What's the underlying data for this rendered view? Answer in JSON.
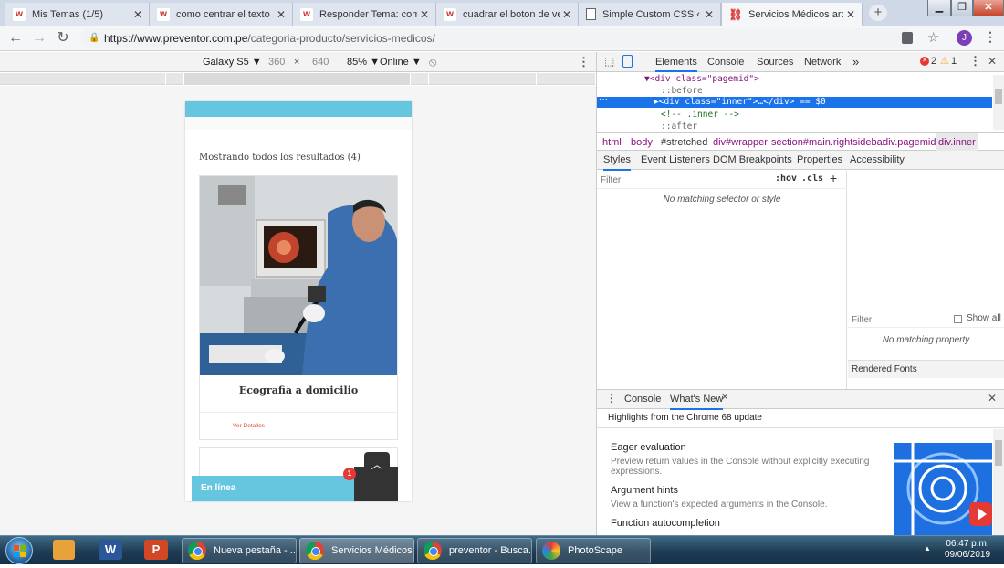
{
  "browser": {
    "tabs": [
      {
        "title": "Mis Temas (1/5)",
        "icon": "w-icon"
      },
      {
        "title": "como centrar el texto",
        "icon": "w-icon"
      },
      {
        "title": "Responder Tema: como",
        "icon": "w-icon"
      },
      {
        "title": "cuadrar el boton de ver",
        "icon": "w-icon"
      },
      {
        "title": "Simple Custom CSS ‹ PR",
        "icon": "doc-icon"
      },
      {
        "title": "Servicios Médicos archiv",
        "icon": "chain-icon"
      }
    ],
    "url_host": "https://www.preventor.com.pe",
    "url_path": "/categoria-producto/servicios-medicos/",
    "profile_initial": "J"
  },
  "device_toolbar": {
    "device": "Galaxy S5 ▼",
    "width": "360",
    "times": "×",
    "height": "640",
    "zoom": "85% ▼",
    "network": "Online ▼"
  },
  "page": {
    "results_text": "Mostrando todos los resultados (4)",
    "product_title": "Ecografia a domicilio",
    "details_link": "Ver Detalles",
    "chat_label": "En línea",
    "chat_badge": "1"
  },
  "devtools": {
    "tabs": [
      "Elements",
      "Console",
      "Sources",
      "Network"
    ],
    "more": "»",
    "errors": "2",
    "warnings": "1",
    "dom_lines": [
      "▼<div class=\"pagemid\">",
      "::before",
      "▶<div class=\"inner\">…</div> == $0",
      "<!-- .inner -->",
      "::after"
    ],
    "breadcrumbs": [
      "html",
      "body",
      "#stretched",
      "div#wrapper",
      "section#main.rightsidebar",
      "div.pagemid",
      "div.inner"
    ],
    "panel_tabs": [
      "Styles",
      "Event Listeners",
      "DOM Breakpoints",
      "Properties",
      "Accessibility"
    ],
    "filter_placeholder": "Filter",
    "hov": ":hov",
    "cls": ".cls",
    "plus": "+",
    "no_style": "No matching selector or style",
    "computed_filter": "Filter",
    "show_all": "Show all",
    "no_property": "No matching property",
    "rendered_fonts": "Rendered Fonts",
    "drawer_tabs": [
      "Console",
      "What's New"
    ],
    "whatsnew_header": "Highlights from the Chrome 68 update",
    "features": [
      {
        "title": "Eager evaluation",
        "desc": "Preview return values in the Console without explicitly executing expressions."
      },
      {
        "title": "Argument hints",
        "desc": "View a function's expected arguments in the Console."
      },
      {
        "title": "Function autocompletion",
        "desc": ""
      }
    ]
  },
  "taskbar": {
    "buttons": [
      "Nueva pestaña - ...",
      "Servicios Médicos...",
      "preventor - Busca...",
      "PhotoScape"
    ],
    "time": "06:47 p.m.",
    "date": "09/06/2019"
  },
  "colors": {
    "accent_teal": "#66c6e0",
    "selected_row": "#1a73e8",
    "error_red": "#e53935",
    "link_red": "#e0463c"
  }
}
